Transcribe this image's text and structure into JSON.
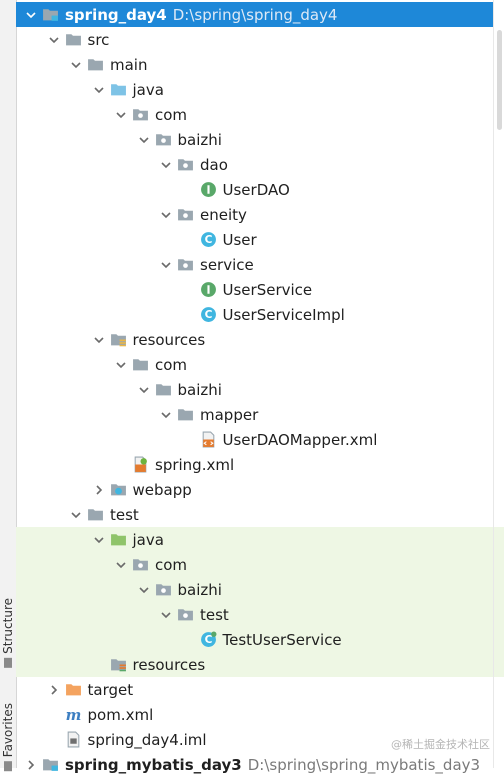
{
  "side_tabs": {
    "structure": "Structure",
    "favorites": "Favorites"
  },
  "watermark": "@稀土掘金技术社区",
  "tree": [
    {
      "depth": 0,
      "arrow": "down",
      "icon": "project-folder-icon",
      "label": "spring_day4",
      "path": "D:\\spring\\spring_day4",
      "selected": true
    },
    {
      "depth": 1,
      "arrow": "down",
      "icon": "folder-icon",
      "label": "src"
    },
    {
      "depth": 2,
      "arrow": "down",
      "icon": "folder-icon",
      "label": "main"
    },
    {
      "depth": 3,
      "arrow": "down",
      "icon": "source-folder-icon",
      "label": "java"
    },
    {
      "depth": 4,
      "arrow": "down",
      "icon": "package-icon",
      "label": "com"
    },
    {
      "depth": 5,
      "arrow": "down",
      "icon": "package-icon",
      "label": "baizhi"
    },
    {
      "depth": 6,
      "arrow": "down",
      "icon": "package-icon",
      "label": "dao"
    },
    {
      "depth": 7,
      "arrow": "none",
      "icon": "interface-icon",
      "label": "UserDAO"
    },
    {
      "depth": 6,
      "arrow": "down",
      "icon": "package-icon",
      "label": "eneity"
    },
    {
      "depth": 7,
      "arrow": "none",
      "icon": "class-icon",
      "label": "User"
    },
    {
      "depth": 6,
      "arrow": "down",
      "icon": "package-icon",
      "label": "service"
    },
    {
      "depth": 7,
      "arrow": "none",
      "icon": "interface-icon",
      "label": "UserService"
    },
    {
      "depth": 7,
      "arrow": "none",
      "icon": "class-icon",
      "label": "UserServiceImpl"
    },
    {
      "depth": 3,
      "arrow": "down",
      "icon": "resources-folder-icon",
      "label": "resources"
    },
    {
      "depth": 4,
      "arrow": "down",
      "icon": "folder-icon",
      "label": "com"
    },
    {
      "depth": 5,
      "arrow": "down",
      "icon": "folder-icon",
      "label": "baizhi"
    },
    {
      "depth": 6,
      "arrow": "down",
      "icon": "folder-icon",
      "label": "mapper"
    },
    {
      "depth": 7,
      "arrow": "none",
      "icon": "xml-file-icon",
      "label": "UserDAOMapper.xml"
    },
    {
      "depth": 4,
      "arrow": "none",
      "icon": "spring-xml-icon",
      "label": "spring.xml"
    },
    {
      "depth": 3,
      "arrow": "right",
      "icon": "web-folder-icon",
      "label": "webapp"
    },
    {
      "depth": 2,
      "arrow": "down",
      "icon": "folder-icon",
      "label": "test"
    },
    {
      "depth": 3,
      "arrow": "down",
      "icon": "test-source-folder-icon",
      "label": "java",
      "green": true
    },
    {
      "depth": 4,
      "arrow": "down",
      "icon": "package-icon",
      "label": "com",
      "green": true
    },
    {
      "depth": 5,
      "arrow": "down",
      "icon": "package-icon",
      "label": "baizhi",
      "green": true
    },
    {
      "depth": 6,
      "arrow": "down",
      "icon": "package-icon",
      "label": "test",
      "green": true
    },
    {
      "depth": 7,
      "arrow": "none",
      "icon": "test-class-icon",
      "label": "TestUserService",
      "green": true
    },
    {
      "depth": 3,
      "arrow": "none",
      "icon": "test-resources-folder-icon",
      "label": "resources",
      "green": true
    },
    {
      "depth": 1,
      "arrow": "right",
      "icon": "excluded-folder-icon",
      "label": "target"
    },
    {
      "depth": 1,
      "arrow": "none",
      "icon": "maven-icon",
      "label": "pom.xml"
    },
    {
      "depth": 1,
      "arrow": "none",
      "icon": "iml-file-icon",
      "label": "spring_day4.iml"
    },
    {
      "depth": 0,
      "arrow": "right",
      "icon": "project-folder-icon",
      "label": "spring_mybatis_day3",
      "path": "D:\\spring\\spring_mybatis_day3"
    }
  ],
  "colors": {
    "selection": "#1e88d8",
    "test_highlight": "#eef7e4",
    "interface_green": "#59a869",
    "class_blue": "#40b6e0",
    "folder_gray": "#9aa7b0",
    "excluded_orange": "#f4a35f"
  }
}
